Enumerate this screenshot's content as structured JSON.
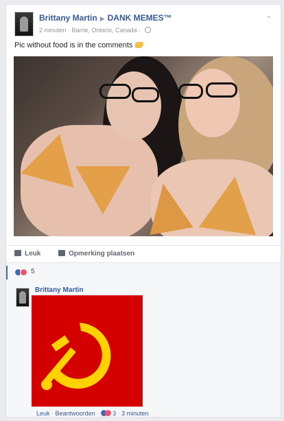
{
  "post": {
    "author": "Brittany Martin",
    "target": "DANK MEMES™",
    "time": "2 minuten",
    "location": "Barrie, Ontario, Canada",
    "text": "Pic without food is in the comments"
  },
  "actions": {
    "like_label": "Leuk",
    "comment_label": "Opmerking plaatsen"
  },
  "reactions": {
    "count": "5"
  },
  "comment": {
    "author": "Brittany Martin",
    "like_label": "Leuk",
    "reply_label": "Beantwoorden",
    "reaction_count": "3",
    "time": "3 minuten"
  },
  "colors": {
    "link": "#365899",
    "flag_red": "#d40000",
    "emblem_yellow": "#ffd200"
  }
}
